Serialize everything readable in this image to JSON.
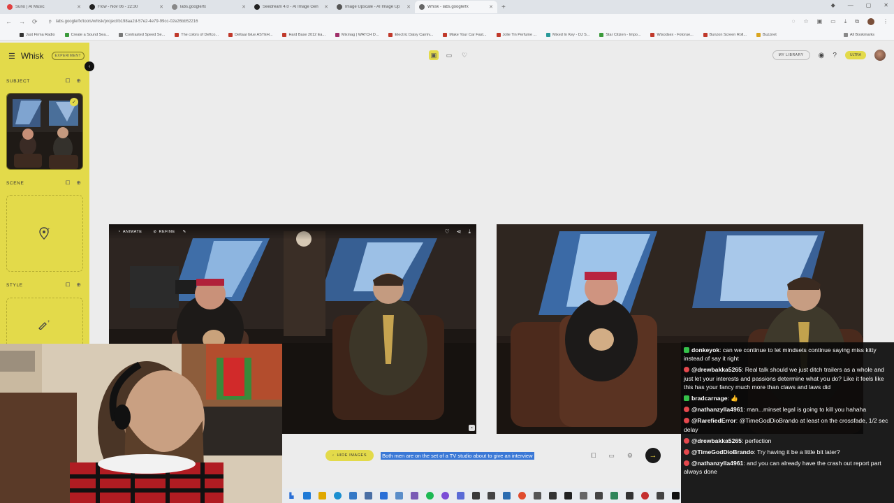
{
  "browser": {
    "tabs": [
      {
        "title": "Suno | AI Music",
        "color": "#e04040"
      },
      {
        "title": "Flow - Nov 06 - 22:30",
        "color": "#222222"
      },
      {
        "title": "labs.google/fx",
        "color": "#888888"
      },
      {
        "title": "Seedream 4.0 - AI Image Gen",
        "color": "#222222"
      },
      {
        "title": "Image Upscale - AI Image Up",
        "color": "#555555"
      },
      {
        "title": "Whisk - labs.google/fx",
        "color": "#666666",
        "active": true
      }
    ],
    "url": "labs.google/fx/tools/whisk/project/b198aa2d-57e2-4e79-99cc-02e26bb52216",
    "bookmarks": [
      "Just Firma Radio",
      "Create a Sound Sea...",
      "Contrasted Speed Se...",
      "The colors of Deftco...",
      "Deltaai Glue ASTEH...",
      "Hard Base 2012 Ea...",
      "Mixmag | WATCH D...",
      "Electric Daisy Carniv...",
      "Make Your Car Fast...",
      "Jolie Tin Perfume ...",
      "Mixed In Key - DJ S...",
      "Star Citizen - Impo...",
      "Wisodsex - Fotorue...",
      "Bunzon Screen Roll...",
      "Buzznet"
    ],
    "all_bookmarks": "All Bookmarks"
  },
  "sidebar": {
    "brand": "Whisk",
    "badge": "EXPERIMENT",
    "sections": {
      "subject": "SUBJECT",
      "scene": "SCENE",
      "style": "STYLE"
    }
  },
  "topbar": {
    "library": "MY LIBRARY",
    "plan": "ULTRA"
  },
  "image_toolbar": {
    "animate": "ANIMATE",
    "refine": "REFINE"
  },
  "prompt": {
    "hide_images": "HIDE IMAGES",
    "text": "Both men are on the set of a TV studio about to give an interview"
  },
  "chat": [
    {
      "badge": "g",
      "user": "donkeyok",
      "text": "can we continue to let mindsets continue saying miss kitty instead of say it right"
    },
    {
      "badge": "r",
      "user": "@drewbakka5265",
      "text": "Real talk should we just ditch trailers as a whole and just let your interests and passions determine what you do? Like it feels like this has your fancy much more than claws and laws did"
    },
    {
      "badge": "g",
      "user": "bradcarnage",
      "text": "👍"
    },
    {
      "badge": "r",
      "user": "@nathanzylla4961",
      "text": "man...minset legal is going to kill you hahaha"
    },
    {
      "badge": "r",
      "user": "@RarefiedError",
      "text": "@TimeGodDioBrando at least on the crossfade, 1/2 sec delay"
    },
    {
      "badge": "r",
      "user": "@drewbakka5265",
      "text": "perfection"
    },
    {
      "badge": "r",
      "user": "@TimeGodDioBrando",
      "text": "Try having it be a little bit later?"
    },
    {
      "badge": "r",
      "user": "@nathanzylla4961",
      "text": "and you can already have the crash out report part always done"
    }
  ],
  "colors": {
    "accent": "#e3da4a",
    "chat_bg": "#0a0a0a"
  }
}
